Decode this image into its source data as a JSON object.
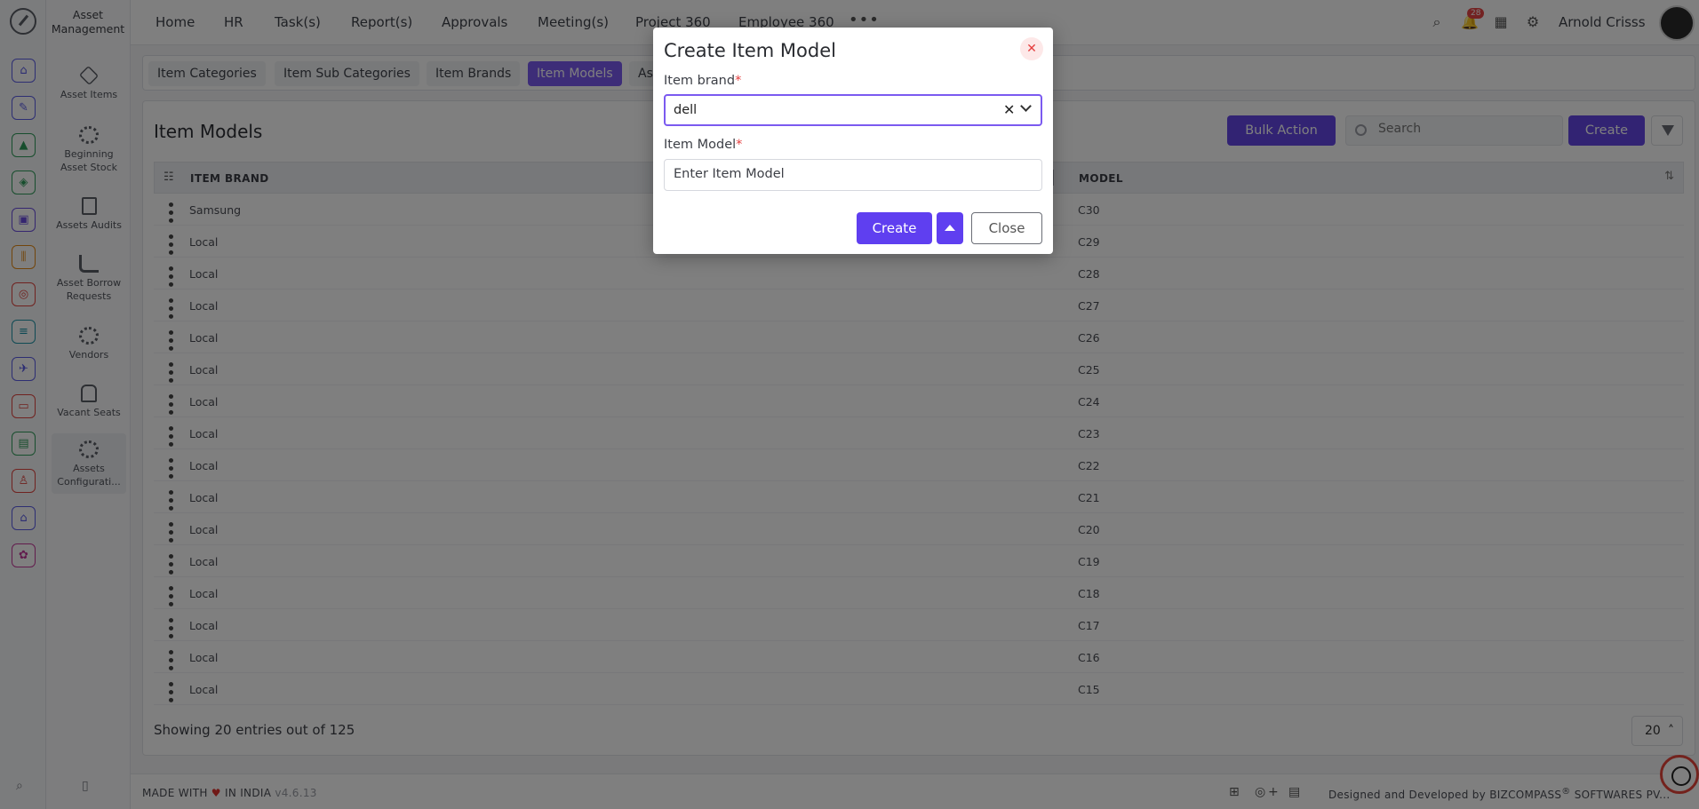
{
  "rail": {
    "icons": [
      {
        "name": "home-icon",
        "color": "#5b5ce6"
      },
      {
        "name": "pin-icon",
        "color": "#5b5ce6"
      },
      {
        "name": "chart-icon",
        "color": "#2e9c5a"
      },
      {
        "name": "bag-icon",
        "color": "#2e9c5a"
      },
      {
        "name": "briefcase-icon",
        "color": "#6a4de0"
      },
      {
        "name": "bars-icon",
        "color": "#e58a16"
      },
      {
        "name": "target-icon",
        "color": "#e0443e"
      },
      {
        "name": "list-icon",
        "color": "#1f95a8"
      },
      {
        "name": "plane-icon",
        "color": "#5b5ce6"
      },
      {
        "name": "monitor-icon",
        "color": "#e0443e"
      },
      {
        "name": "file-icon",
        "color": "#2e9c5a"
      },
      {
        "name": "badge-icon",
        "color": "#e0443e"
      },
      {
        "name": "building-icon",
        "color": "#5b5ce6"
      },
      {
        "name": "cog-pink-icon",
        "color": "#c4389a"
      }
    ]
  },
  "module": {
    "title_line1": "Asset",
    "title_line2": "Management",
    "items": [
      {
        "label": "Asset Items"
      },
      {
        "label": "Beginning Asset Stock"
      },
      {
        "label": "Assets Audits"
      },
      {
        "label": "Asset Borrow Requests"
      },
      {
        "label": "Vendors"
      },
      {
        "label": "Vacant Seats"
      },
      {
        "label": "Assets Configurati..."
      }
    ]
  },
  "topnav": {
    "items": [
      "Home",
      "HR",
      "Task(s)",
      "Report(s)",
      "Approvals",
      "Meeting(s)",
      "Project 360",
      "Employee 360"
    ],
    "notification_count": "28",
    "user_name": "Arnold Crisss"
  },
  "subtabs": [
    "Item Categories",
    "Item Sub Categories",
    "Item Brands",
    "Item Models",
    "As"
  ],
  "panel": {
    "title": "Item Models",
    "bulk_action": "Bulk Action",
    "search_placeholder": "Search",
    "create": "Create",
    "columns": [
      "ITEM BRAND",
      "MODEL"
    ],
    "rows": [
      [
        "Samsung",
        "C30"
      ],
      [
        "Local",
        "C29"
      ],
      [
        "Local",
        "C28"
      ],
      [
        "Local",
        "C27"
      ],
      [
        "Local",
        "C26"
      ],
      [
        "Local",
        "C25"
      ],
      [
        "Local",
        "C24"
      ],
      [
        "Local",
        "C23"
      ],
      [
        "Local",
        "C22"
      ],
      [
        "Local",
        "C21"
      ],
      [
        "Local",
        "C20"
      ],
      [
        "Local",
        "C19"
      ],
      [
        "Local",
        "C18"
      ],
      [
        "Local",
        "C17"
      ],
      [
        "Local",
        "C16"
      ],
      [
        "Local",
        "C15"
      ]
    ],
    "showing": "Showing 20 entries out of 125",
    "page_size": "20"
  },
  "footer": {
    "made_with": "MADE WITH",
    "in_india": "IN INDIA",
    "version": "v4.6.13",
    "designed_by": "Designed and Developed by",
    "company": "BIZCOMPASS",
    "company_mark": "®",
    "company_suffix": "SOFTWARES PV..."
  },
  "modal": {
    "title": "Create Item Model",
    "brand_label": "Item brand",
    "brand_value": "dell",
    "model_label": "Item Model",
    "model_placeholder": "Enter Item Model",
    "create_button": "Create",
    "close_button": "Close",
    "required_mark": "*"
  }
}
